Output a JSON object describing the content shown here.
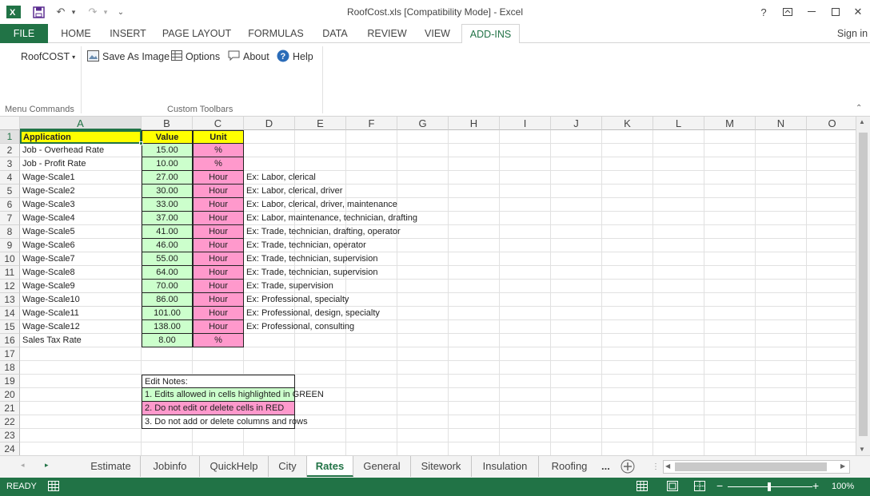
{
  "window": {
    "title": "RoofCost.xls  [Compatibility Mode] - Excel",
    "help_label": "?",
    "signin_label": "Sign in"
  },
  "ribbon_tabs": [
    {
      "label": "FILE"
    },
    {
      "label": "HOME"
    },
    {
      "label": "INSERT"
    },
    {
      "label": "PAGE LAYOUT"
    },
    {
      "label": "FORMULAS"
    },
    {
      "label": "DATA"
    },
    {
      "label": "REVIEW"
    },
    {
      "label": "VIEW"
    },
    {
      "label": "ADD-INS"
    }
  ],
  "ribbon": {
    "roofcost_menu": "RoofCOST",
    "save_as_image": "Save As Image",
    "options": "Options",
    "about": "About",
    "help": "Help",
    "group_menu_commands": "Menu Commands",
    "group_custom_toolbars": "Custom Toolbars"
  },
  "columns": [
    "A",
    "B",
    "C",
    "D",
    "E",
    "F",
    "G",
    "H",
    "I",
    "J",
    "K",
    "L",
    "M",
    "N",
    "O"
  ],
  "rows": [
    "1",
    "2",
    "3",
    "4",
    "5",
    "6",
    "7",
    "8",
    "9",
    "10",
    "11",
    "12",
    "13",
    "14",
    "15",
    "16",
    "17",
    "18",
    "19",
    "20",
    "21",
    "22",
    "23",
    "24"
  ],
  "table": {
    "headers": [
      "Application",
      "Value",
      "Unit"
    ],
    "data": [
      {
        "application": "Job - Overhead Rate",
        "value": "15.00",
        "unit": "%",
        "note": ""
      },
      {
        "application": "Job - Profit Rate",
        "value": "10.00",
        "unit": "%",
        "note": ""
      },
      {
        "application": "Wage-Scale1",
        "value": "27.00",
        "unit": "Hour",
        "note": "Ex: Labor, clerical"
      },
      {
        "application": "Wage-Scale2",
        "value": "30.00",
        "unit": "Hour",
        "note": "Ex: Labor, clerical, driver"
      },
      {
        "application": "Wage-Scale3",
        "value": "33.00",
        "unit": "Hour",
        "note": "Ex: Labor, clerical, driver, maintenance"
      },
      {
        "application": "Wage-Scale4",
        "value": "37.00",
        "unit": "Hour",
        "note": "Ex: Labor, maintenance, technician, drafting"
      },
      {
        "application": "Wage-Scale5",
        "value": "41.00",
        "unit": "Hour",
        "note": "Ex: Trade, technician, drafting, operator"
      },
      {
        "application": "Wage-Scale6",
        "value": "46.00",
        "unit": "Hour",
        "note": "Ex: Trade, technician, operator"
      },
      {
        "application": "Wage-Scale7",
        "value": "55.00",
        "unit": "Hour",
        "note": "Ex: Trade, technician, supervision"
      },
      {
        "application": "Wage-Scale8",
        "value": "64.00",
        "unit": "Hour",
        "note": "Ex: Trade, technician, supervision"
      },
      {
        "application": "Wage-Scale9",
        "value": "70.00",
        "unit": "Hour",
        "note": "Ex: Trade, supervision"
      },
      {
        "application": "Wage-Scale10",
        "value": "86.00",
        "unit": "Hour",
        "note": "Ex: Professional, specialty"
      },
      {
        "application": "Wage-Scale11",
        "value": "101.00",
        "unit": "Hour",
        "note": "Ex: Professional, design, specialty"
      },
      {
        "application": "Wage-Scale12",
        "value": "138.00",
        "unit": "Hour",
        "note": "Ex: Professional, consulting"
      },
      {
        "application": "Sales Tax Rate",
        "value": "8.00",
        "unit": "%",
        "note": ""
      }
    ]
  },
  "edit_notes": {
    "title": "Edit Notes:",
    "note1": "1. Edits allowed in cells highlighted in GREEN",
    "note2": "2. Do not edit or delete cells in RED",
    "note3": "3. Do not add or delete columns and rows"
  },
  "sheet_tabs": [
    {
      "label": "Estimate"
    },
    {
      "label": "Jobinfo"
    },
    {
      "label": "QuickHelp"
    },
    {
      "label": "City"
    },
    {
      "label": "Rates"
    },
    {
      "label": "General"
    },
    {
      "label": "Sitework"
    },
    {
      "label": "Insulation"
    },
    {
      "label": "Roofing"
    }
  ],
  "sheet_more": "...",
  "status": {
    "ready": "READY",
    "zoom": "100%"
  },
  "colors": {
    "excel_green": "#217346",
    "editable_green": "#ccffcc",
    "locked_pink": "#ff99cc",
    "header_yellow": "#ffff00"
  }
}
